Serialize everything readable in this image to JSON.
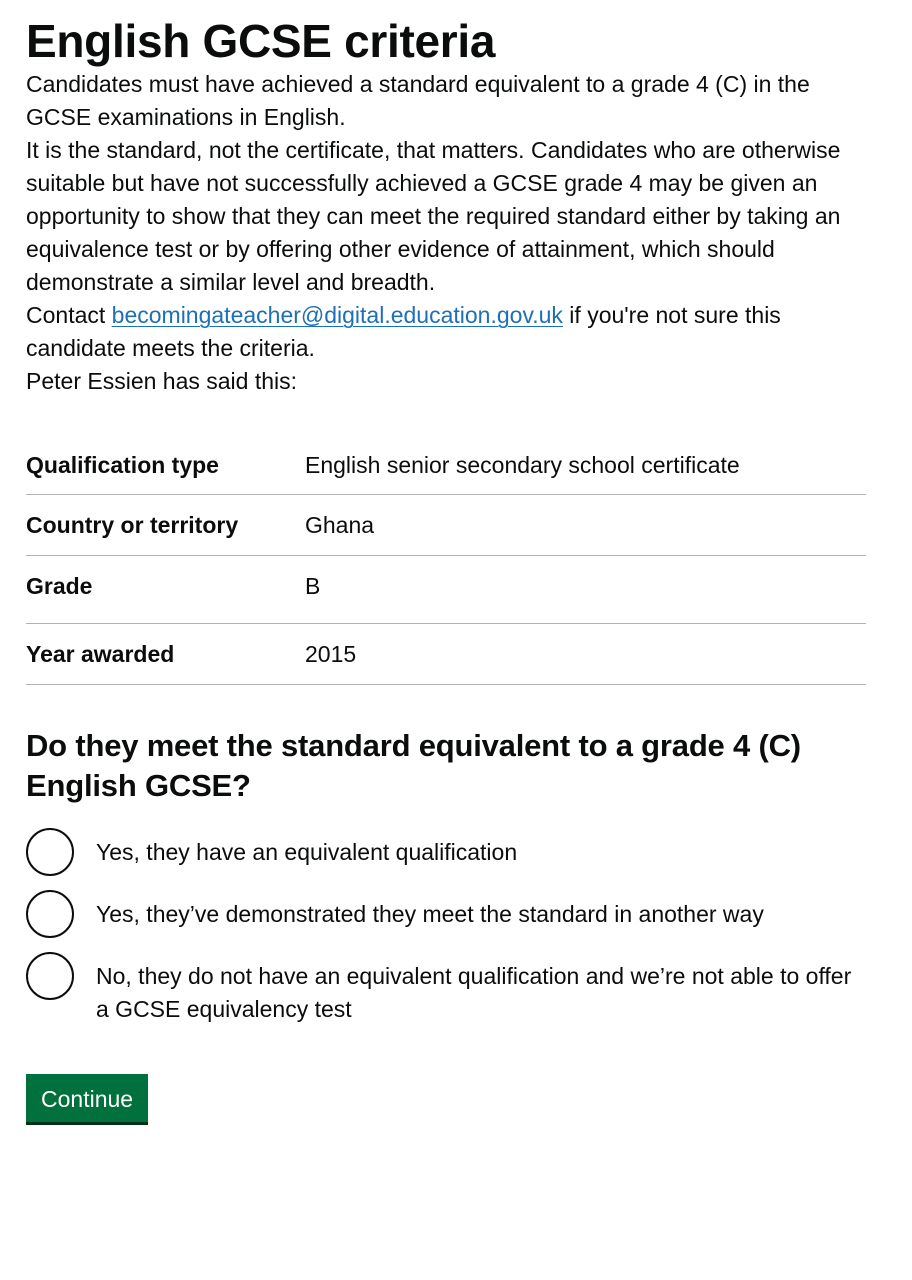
{
  "page": {
    "title": "English GCSE criteria",
    "paragraphs": [
      "Candidates must have achieved a standard equivalent to a grade 4 (C) in the GCSE examinations in English.",
      "It is the standard, not the certificate, that matters. Candidates who are otherwise suitable but have not successfully achieved a GCSE grade 4 may be given an opportunity to show that they can meet the required standard either by taking an equivalence test or by offering other evidence of attainment, which should demonstrate a similar level and breadth."
    ],
    "contact": {
      "prefix": "Contact ",
      "email": "becomingateacher@digital.education.gov.uk",
      "suffix": " if you're not sure this candidate meets the criteria."
    },
    "candidate_statement": "Peter Essien has said this:"
  },
  "summary": {
    "rows": [
      {
        "key": "Qualification type",
        "value": "English senior secondary school certificate"
      },
      {
        "key": "Country or territory",
        "value": "Ghana"
      },
      {
        "key": "Grade",
        "value": "B"
      },
      {
        "key": "Year awarded",
        "value": "2015"
      }
    ]
  },
  "question": {
    "heading": "Do they meet the standard equivalent to a grade 4 (C) English GCSE?",
    "options": [
      "Yes, they have an equivalent qualification",
      "Yes, they’ve demonstrated they meet the standard in another way",
      "No, they do not have an equivalent qualification and we’re not able to offer a GCSE equivalency test"
    ]
  },
  "actions": {
    "continue_label": "Continue"
  },
  "colors": {
    "link": "#1d70b8",
    "button": "#00703c",
    "text": "#0b0c0c",
    "border": "#b1b4b6"
  }
}
